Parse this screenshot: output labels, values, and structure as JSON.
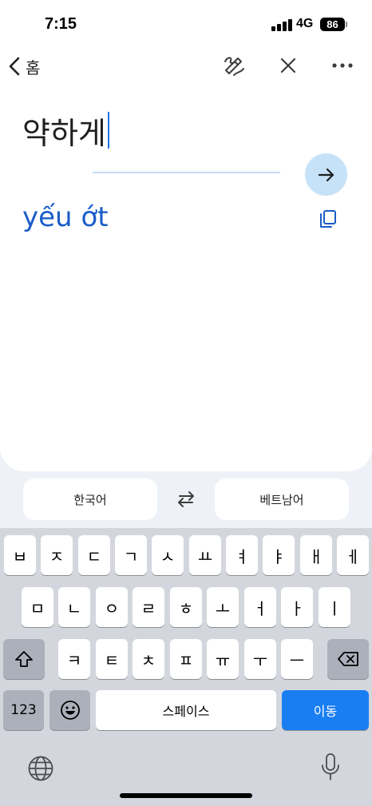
{
  "status": {
    "time": "7:15",
    "network": "4G",
    "battery": "86"
  },
  "header": {
    "back_label": "홈"
  },
  "input": {
    "text": "약하게"
  },
  "output": {
    "text": "yếu ớt"
  },
  "languages": {
    "source": "한국어",
    "target": "베트남어"
  },
  "keyboard": {
    "row1": [
      "ㅂ",
      "ㅈ",
      "ㄷ",
      "ㄱ",
      "ㅅ",
      "ㅛ",
      "ㅕ",
      "ㅑ",
      "ㅐ",
      "ㅔ"
    ],
    "row2": [
      "ㅁ",
      "ㄴ",
      "ㅇ",
      "ㄹ",
      "ㅎ",
      "ㅗ",
      "ㅓ",
      "ㅏ",
      "ㅣ"
    ],
    "row3": [
      "ㅋ",
      "ㅌ",
      "ㅊ",
      "ㅍ",
      "ㅠ",
      "ㅜ",
      "ㅡ"
    ],
    "numbers_label": "123",
    "space_label": "스페이스",
    "go_label": "이동"
  },
  "colors": {
    "accent": "#1a73e8",
    "result_text": "#1a5cc8",
    "go_key": "#1a7ef3",
    "go_button_bg": "#c6e2f9"
  }
}
